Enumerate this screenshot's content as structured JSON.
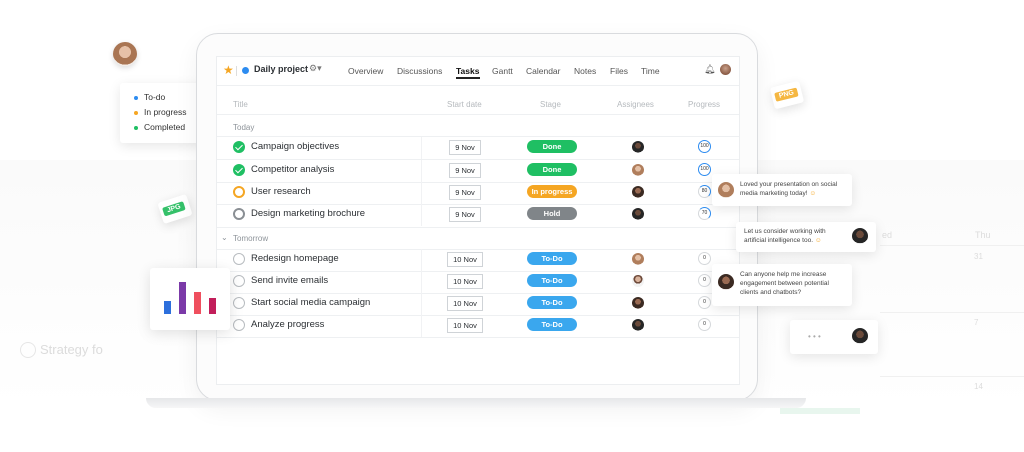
{
  "legend": {
    "items": [
      {
        "label": "To-do",
        "color": "#2d8cf0"
      },
      {
        "label": "In progress",
        "color": "#f5a623"
      },
      {
        "label": "Completed",
        "color": "#1fbf63"
      }
    ]
  },
  "files": {
    "png_label": "PNG",
    "jpg_label": "JPG"
  },
  "header": {
    "project_title": "Daily project",
    "tabs": [
      "Overview",
      "Discussions",
      "Tasks",
      "Gantt",
      "Calendar",
      "Notes",
      "Files",
      "Time"
    ],
    "active_tab": "Tasks"
  },
  "columns": {
    "title": "Title",
    "start_date": "Start date",
    "stage": "Stage",
    "assignees": "Assignees",
    "progress": "Progress"
  },
  "sections": {
    "today": "Today",
    "tomorrow": "Tomorrow"
  },
  "tasks": [
    {
      "title": "Campaign objectives",
      "date": "9 Nov",
      "stage": "Done",
      "progress": "100"
    },
    {
      "title": "Competitor analysis",
      "date": "9 Nov",
      "stage": "Done",
      "progress": "100"
    },
    {
      "title": "User research",
      "date": "9 Nov",
      "stage": "In progress",
      "progress": "80"
    },
    {
      "title": "Design marketing brochure",
      "date": "9 Nov",
      "stage": "Hold",
      "progress": "70"
    },
    {
      "title": "Redesign homepage",
      "date": "10 Nov",
      "stage": "To-Do",
      "progress": "0"
    },
    {
      "title": "Send invite emails",
      "date": "10 Nov",
      "stage": "To-Do",
      "progress": "0"
    },
    {
      "title": "Start social media campaign",
      "date": "10 Nov",
      "stage": "To-Do",
      "progress": "0"
    },
    {
      "title": "Analyze progress",
      "date": "10 Nov",
      "stage": "To-Do",
      "progress": "0"
    }
  ],
  "stage_colors": {
    "Done": "#1fbf63",
    "In progress": "#f5a623",
    "Hold": "#808589",
    "To-Do": "#3aa7ee"
  },
  "chat": [
    {
      "text_1": "Loved your presentation on social",
      "text_2": "media marketing today! ",
      "emoji": "☺"
    },
    {
      "text_1": "Let us consider working with",
      "text_2": "artificial intelligence too. ",
      "emoji": "☺"
    },
    {
      "text_1": "Can anyone help me increase",
      "text_2": "engagement between potential",
      "text_3": "clients and chatbots?"
    }
  ],
  "typing_indicator": "• • •",
  "background_ghost": {
    "col_wed": "ed",
    "col_thu": "Thu",
    "day_a": "31",
    "day_b": "7",
    "day_c": "14",
    "strategy": "Strategy fo"
  },
  "bar_card": {
    "values": [
      4,
      10,
      7,
      5
    ],
    "colors": [
      "#2d6fdc",
      "#7b3aa8",
      "#ef4f5e",
      "#c21e5a"
    ]
  }
}
